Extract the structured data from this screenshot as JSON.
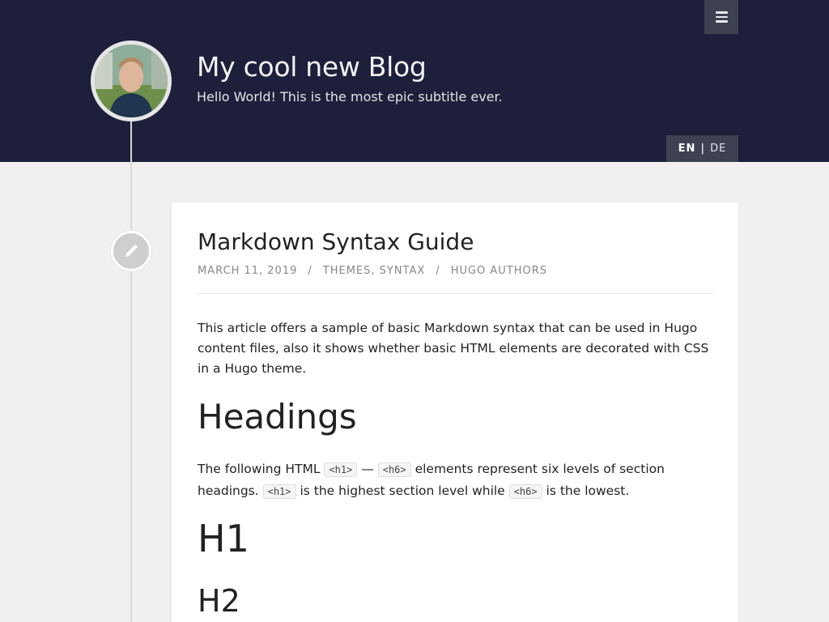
{
  "header": {
    "site_title": "My cool new Blog",
    "site_subtitle": "Hello World! This is the most epic subtitle ever.",
    "menu_icon": "hamburger-icon",
    "lang": {
      "active": "EN",
      "separator": "|",
      "other": "DE"
    },
    "colors": {
      "header_bg": "#1e1f3b",
      "button_bg": "#3e4152"
    }
  },
  "post": {
    "icon": "pencil-icon",
    "title": "Markdown Syntax Guide",
    "meta": {
      "date": "MARCH 11, 2019",
      "sep": "/",
      "categories": "THEMES, SYNTAX",
      "author": "HUGO AUTHORS"
    },
    "intro": "This article offers a sample of basic Markdown syntax that can be used in Hugo content files, also it shows whether basic HTML elements are decorated with CSS in a Hugo theme.",
    "headings_title": "Headings",
    "desc": {
      "p1": "The following HTML",
      "code_h1": "<h1>",
      "dash": "—",
      "code_h6": "<h6>",
      "p2": "elements represent six levels of section headings.",
      "p3": "is the highest section level while",
      "p4": "is the lowest."
    },
    "h1_sample": "H1",
    "h2_sample": "H2"
  }
}
